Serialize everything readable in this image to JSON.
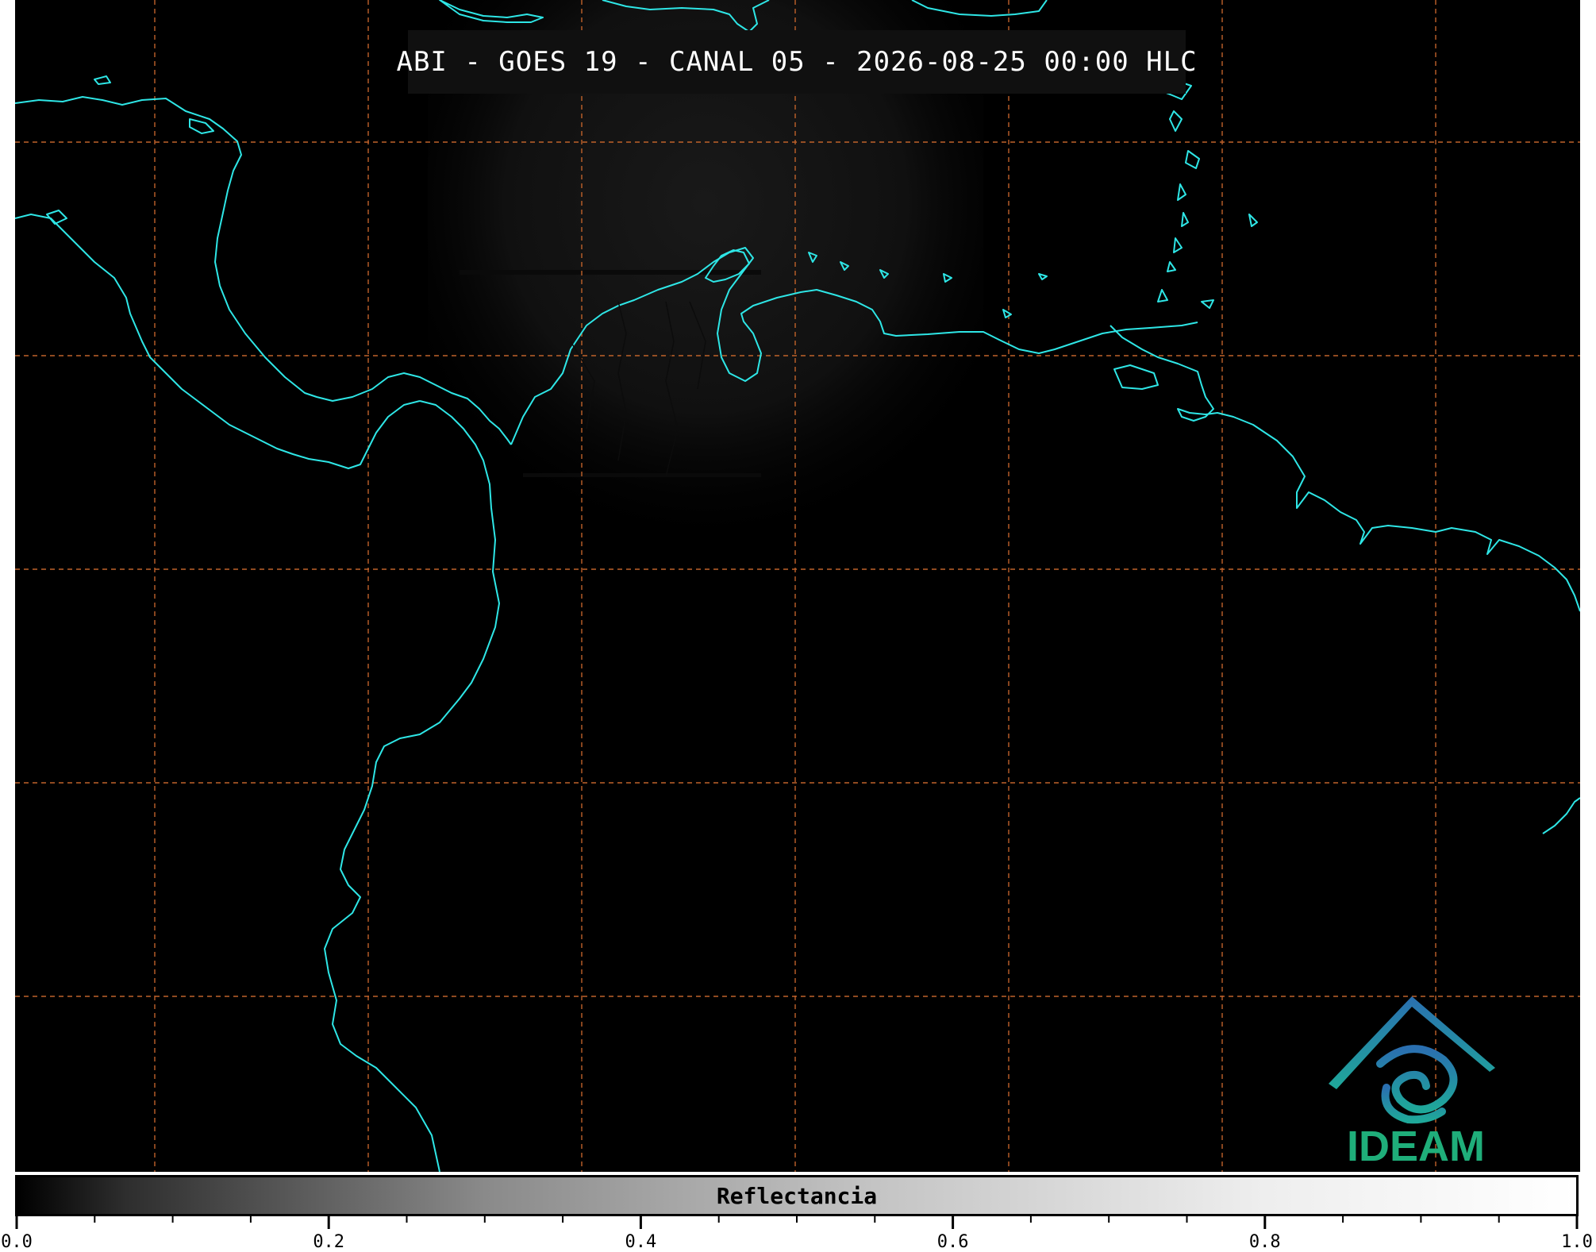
{
  "title": "ABI - GOES 19 - CANAL 05 - 2026-08-25 00:00 HLC",
  "colorbar": {
    "label": "Reflectancia",
    "range": [
      0.0,
      1.0
    ],
    "tick_labels": [
      "0.0",
      "0.2",
      "0.4",
      "0.6",
      "0.8",
      "1.0"
    ],
    "gradient": "grayscale black-to-white"
  },
  "logo": {
    "text": "IDEAM",
    "icon": "ideam-mountain-swirl-logo"
  },
  "colors": {
    "background": "#000000",
    "coastline": "#2ee6e6",
    "graticule": "#c0622a",
    "logo_text": "#1fae7a",
    "logo_mark_top": "#2a6fb0",
    "logo_mark_bottom": "#1fa89a"
  },
  "map": {
    "graticule": "dashed orange lat/lon grid",
    "coastlines": "cyan"
  }
}
